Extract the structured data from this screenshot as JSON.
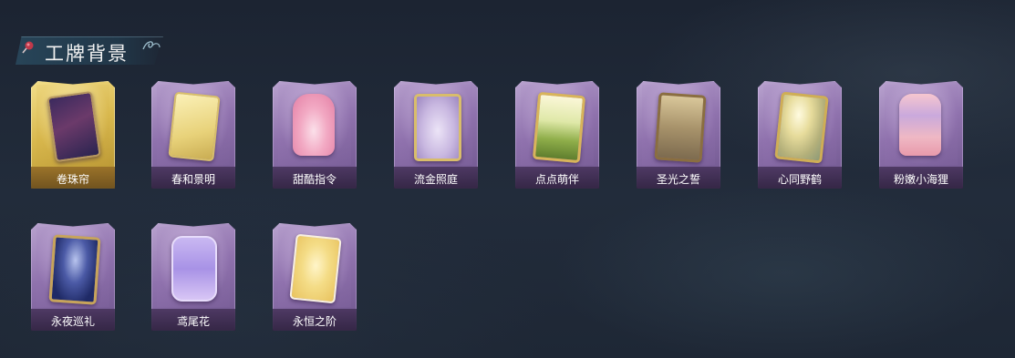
{
  "section": {
    "title": "工牌背景",
    "icons": [
      "pin-icon",
      "swirl-icon"
    ]
  },
  "colors": {
    "background": "#1f2938",
    "card_frame": "#8f72ad",
    "card_selected_frame": "#d9b94e",
    "label_text": "#ffffff"
  },
  "badges": [
    {
      "label": "卷珠帘",
      "selected": true,
      "art": "dark-curtain-card"
    },
    {
      "label": "春和景明",
      "selected": false,
      "art": "golden-ornate-card"
    },
    {
      "label": "甜酷指令",
      "selected": false,
      "art": "pink-monster-card"
    },
    {
      "label": "流金照庭",
      "selected": false,
      "art": "gold-frame-crystal-card"
    },
    {
      "label": "点点萌伴",
      "selected": false,
      "art": "green-meadow-card"
    },
    {
      "label": "圣光之誓",
      "selected": false,
      "art": "holy-light-card"
    },
    {
      "label": "心同野鹤",
      "selected": false,
      "art": "crane-sunlight-card"
    },
    {
      "label": "粉嫩小海狸",
      "selected": false,
      "art": "pink-beaver-card"
    },
    {
      "label": "永夜巡礼",
      "selected": false,
      "art": "night-moon-card"
    },
    {
      "label": "鸢尾花",
      "selected": false,
      "art": "iris-lavender-card"
    },
    {
      "label": "永恒之阶",
      "selected": false,
      "art": "eternal-steps-card"
    }
  ]
}
